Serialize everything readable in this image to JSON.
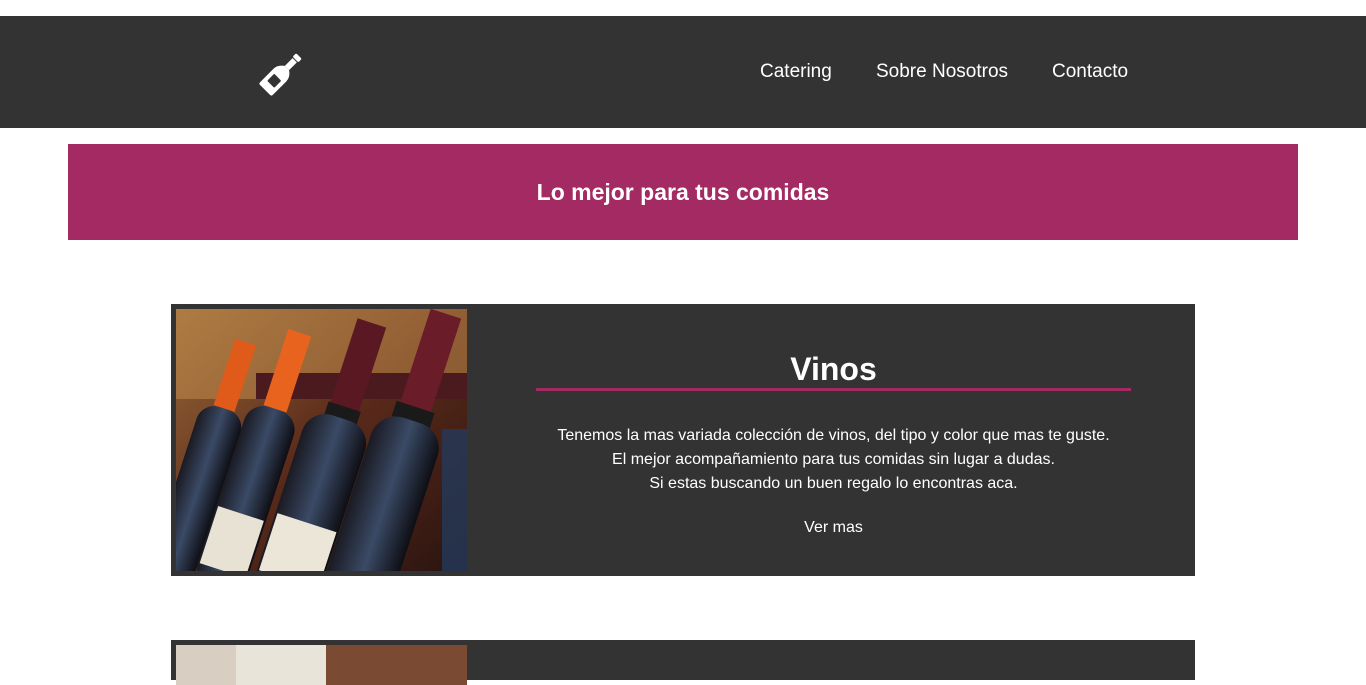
{
  "header": {
    "logo_icon": "wine-bottle-icon",
    "nav": [
      {
        "label": "Catering"
      },
      {
        "label": "Sobre Nosotros"
      },
      {
        "label": "Contacto"
      }
    ]
  },
  "banner": {
    "title": "Lo mejor para tus comidas"
  },
  "cards": [
    {
      "title": "Vinos",
      "lines": [
        "Tenemos la mas variada colección de vinos, del tipo y color que mas te guste.",
        "El mejor acompañamiento para tus comidas sin lugar a dudas.",
        "Si estas buscando un buen regalo lo encontras aca."
      ],
      "link": "Ver mas"
    }
  ],
  "colors": {
    "dark": "#333333",
    "accent": "#a32a63",
    "text": "#ffffff"
  }
}
